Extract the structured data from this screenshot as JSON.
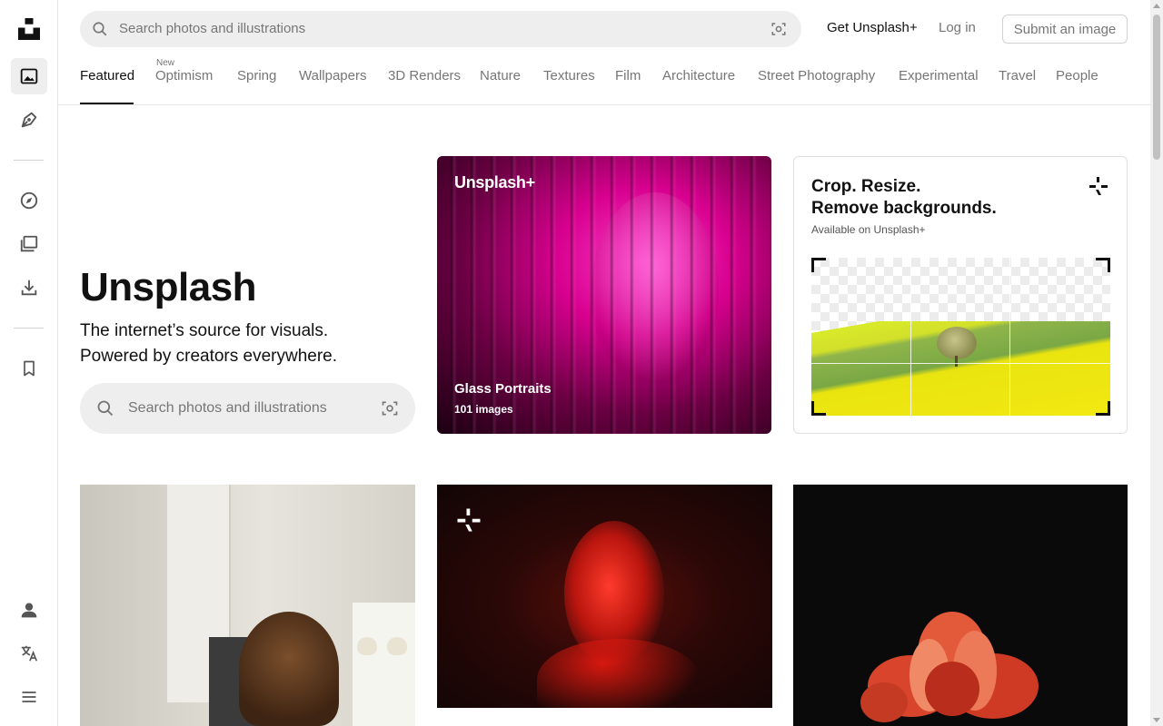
{
  "header": {
    "search_placeholder": "Search photos and illustrations",
    "get_plus": "Get Unsplash+",
    "login": "Log in",
    "submit": "Submit an image"
  },
  "tabs": [
    {
      "label": "Featured",
      "active": true
    },
    {
      "label": "Optimism",
      "badge": "New"
    },
    {
      "label": "Spring"
    },
    {
      "label": "Wallpapers"
    },
    {
      "label": "3D Renders"
    },
    {
      "label": "Nature"
    },
    {
      "label": "Textures"
    },
    {
      "label": "Film"
    },
    {
      "label": "Architecture"
    },
    {
      "label": "Street Photography"
    },
    {
      "label": "Experimental"
    },
    {
      "label": "Travel"
    },
    {
      "label": "People"
    }
  ],
  "hero": {
    "title": "Unsplash",
    "subtitle_line1": "The internet’s source for visuals.",
    "subtitle_line2": "Powered by creators everywhere.",
    "search_placeholder": "Search photos and illustrations"
  },
  "promo": {
    "brand": "Unsplash+",
    "title": "Glass Portraits",
    "count": "101 images"
  },
  "crop_card": {
    "line1": "Crop. Resize.",
    "line2": "Remove backgrounds.",
    "note": "Available on Unsplash+"
  },
  "sidebar": {
    "items": [
      "unsplash-logo",
      "photos-icon",
      "illustrations-icon",
      "explore-icon",
      "collections-icon",
      "download-icon",
      "bookmark-icon",
      "account-icon",
      "language-icon",
      "menu-icon"
    ]
  },
  "colors": {
    "accent_text": "#111111",
    "muted_text": "#767676",
    "search_bg": "#eeeeee"
  }
}
